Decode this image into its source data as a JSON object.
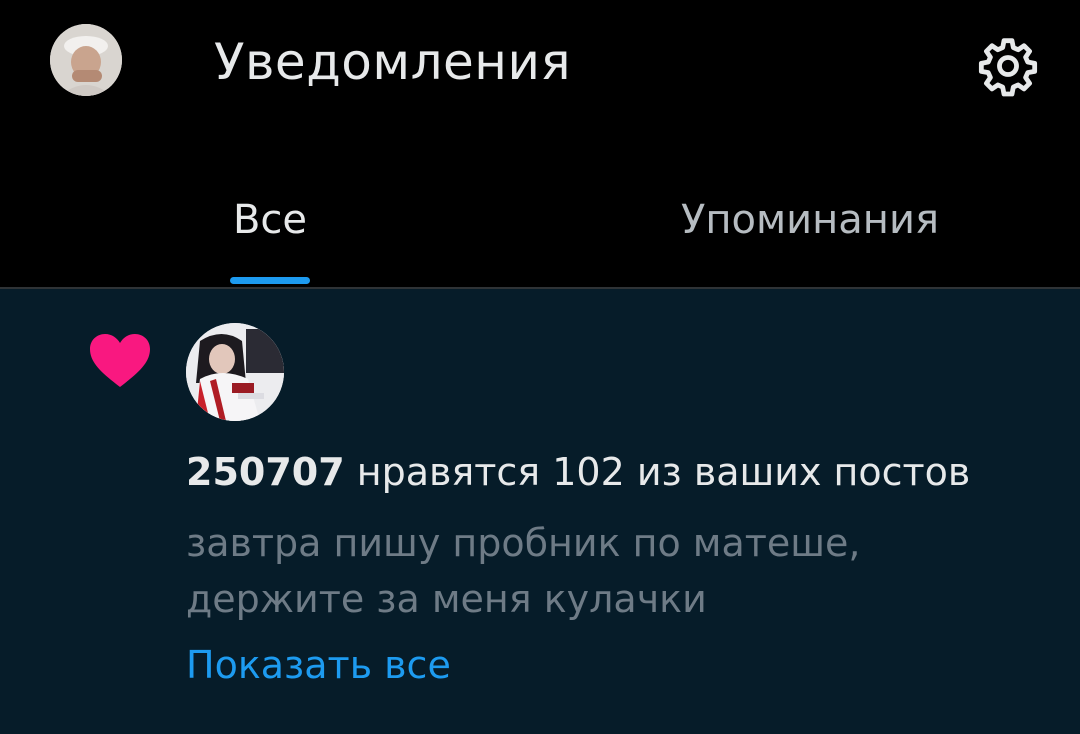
{
  "header": {
    "title": "Уведомления",
    "profile_icon": "avatar",
    "settings_icon": "gear-icon"
  },
  "tabs": [
    {
      "label": "Все",
      "active": true
    },
    {
      "label": "Упоминания",
      "active": false
    }
  ],
  "notification": {
    "icon": "heart-icon",
    "icon_color": "#f91880",
    "user": "250707",
    "action": "нравятся 102 из ваших постов",
    "preview": "завтра пишу пробник по матеше, держите за меня кулачки",
    "show_all": "Показать все"
  },
  "colors": {
    "accent": "#1d9bf0",
    "like": "#f91880",
    "card_background": "#061c29"
  }
}
